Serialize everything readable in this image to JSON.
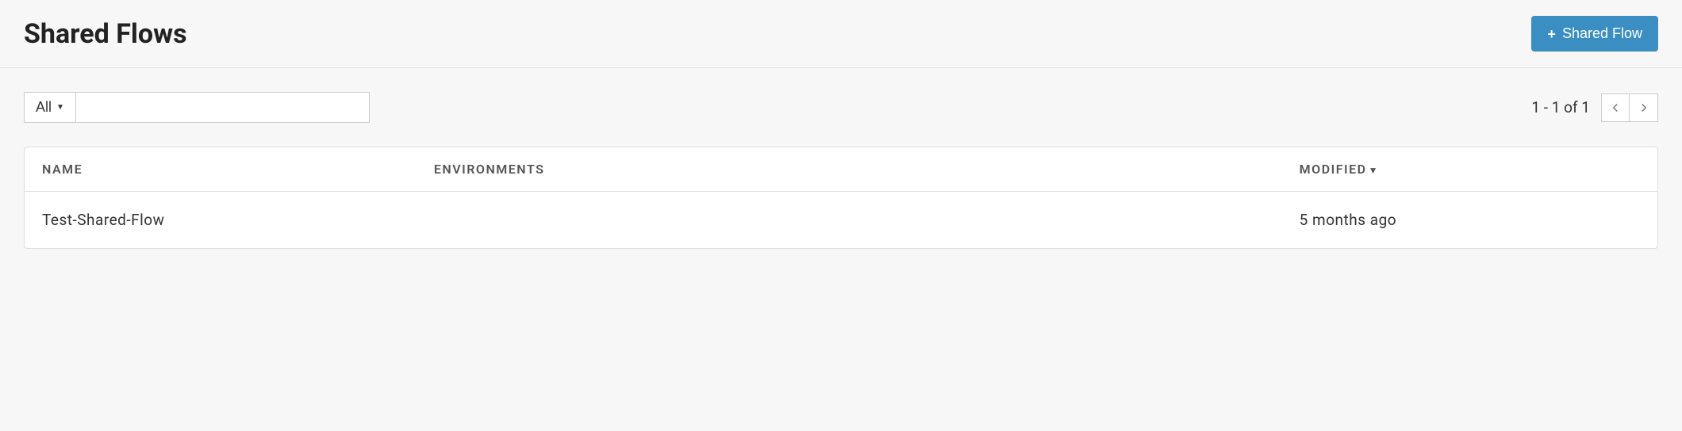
{
  "header": {
    "title": "Shared Flows",
    "add_button_label": "Shared Flow"
  },
  "toolbar": {
    "filter_selected": "All",
    "search_value": "",
    "search_placeholder": ""
  },
  "pagination": {
    "range_text": "1 - 1 of 1"
  },
  "table": {
    "columns": {
      "name": "NAME",
      "environments": "ENVIRONMENTS",
      "modified": "MODIFIED"
    },
    "sort_indicator": "▼",
    "rows": [
      {
        "name": "Test-Shared-Flow",
        "environments": "",
        "modified": "5 months ago"
      }
    ]
  }
}
